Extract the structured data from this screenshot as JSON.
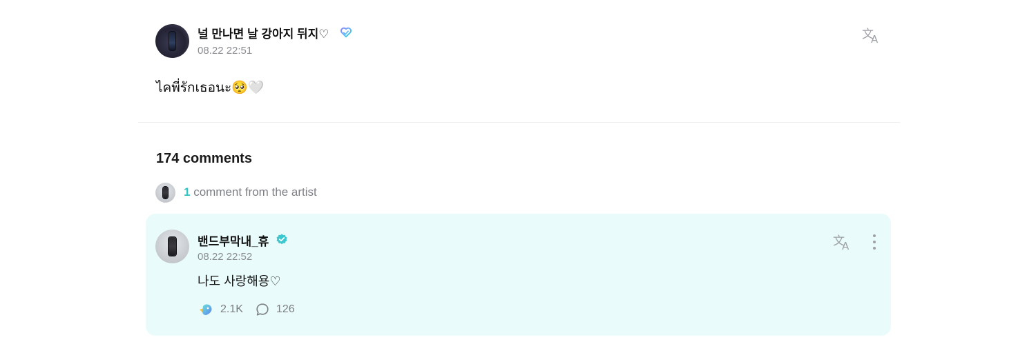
{
  "post": {
    "author_name": "널 만나면 날 강아지 뒤지♡",
    "timestamp": "08.22 22:51",
    "body": "ไคพี่รักเธอนะ🥺🤍",
    "avatar_icon": "avatar-image",
    "badge_icon": "heart-badge-icon",
    "translate_icon": "translate-icon"
  },
  "comments": {
    "count_label": "174 comments",
    "artist_filter": {
      "count": "1",
      "label": " comment from the artist"
    },
    "items": [
      {
        "author_name": "밴드부막내_휴",
        "timestamp": "08.22 22:52",
        "body": "나도 사랑해용♡",
        "likes": "2.1K",
        "replies": "126",
        "is_artist": true,
        "badge_icon": "verified-check-icon",
        "highlight_color": "#e9fbfa"
      }
    ]
  },
  "colors": {
    "accent": "#31c2c6",
    "muted_text": "#8a8d93",
    "card_background": "#e9fbfa"
  }
}
